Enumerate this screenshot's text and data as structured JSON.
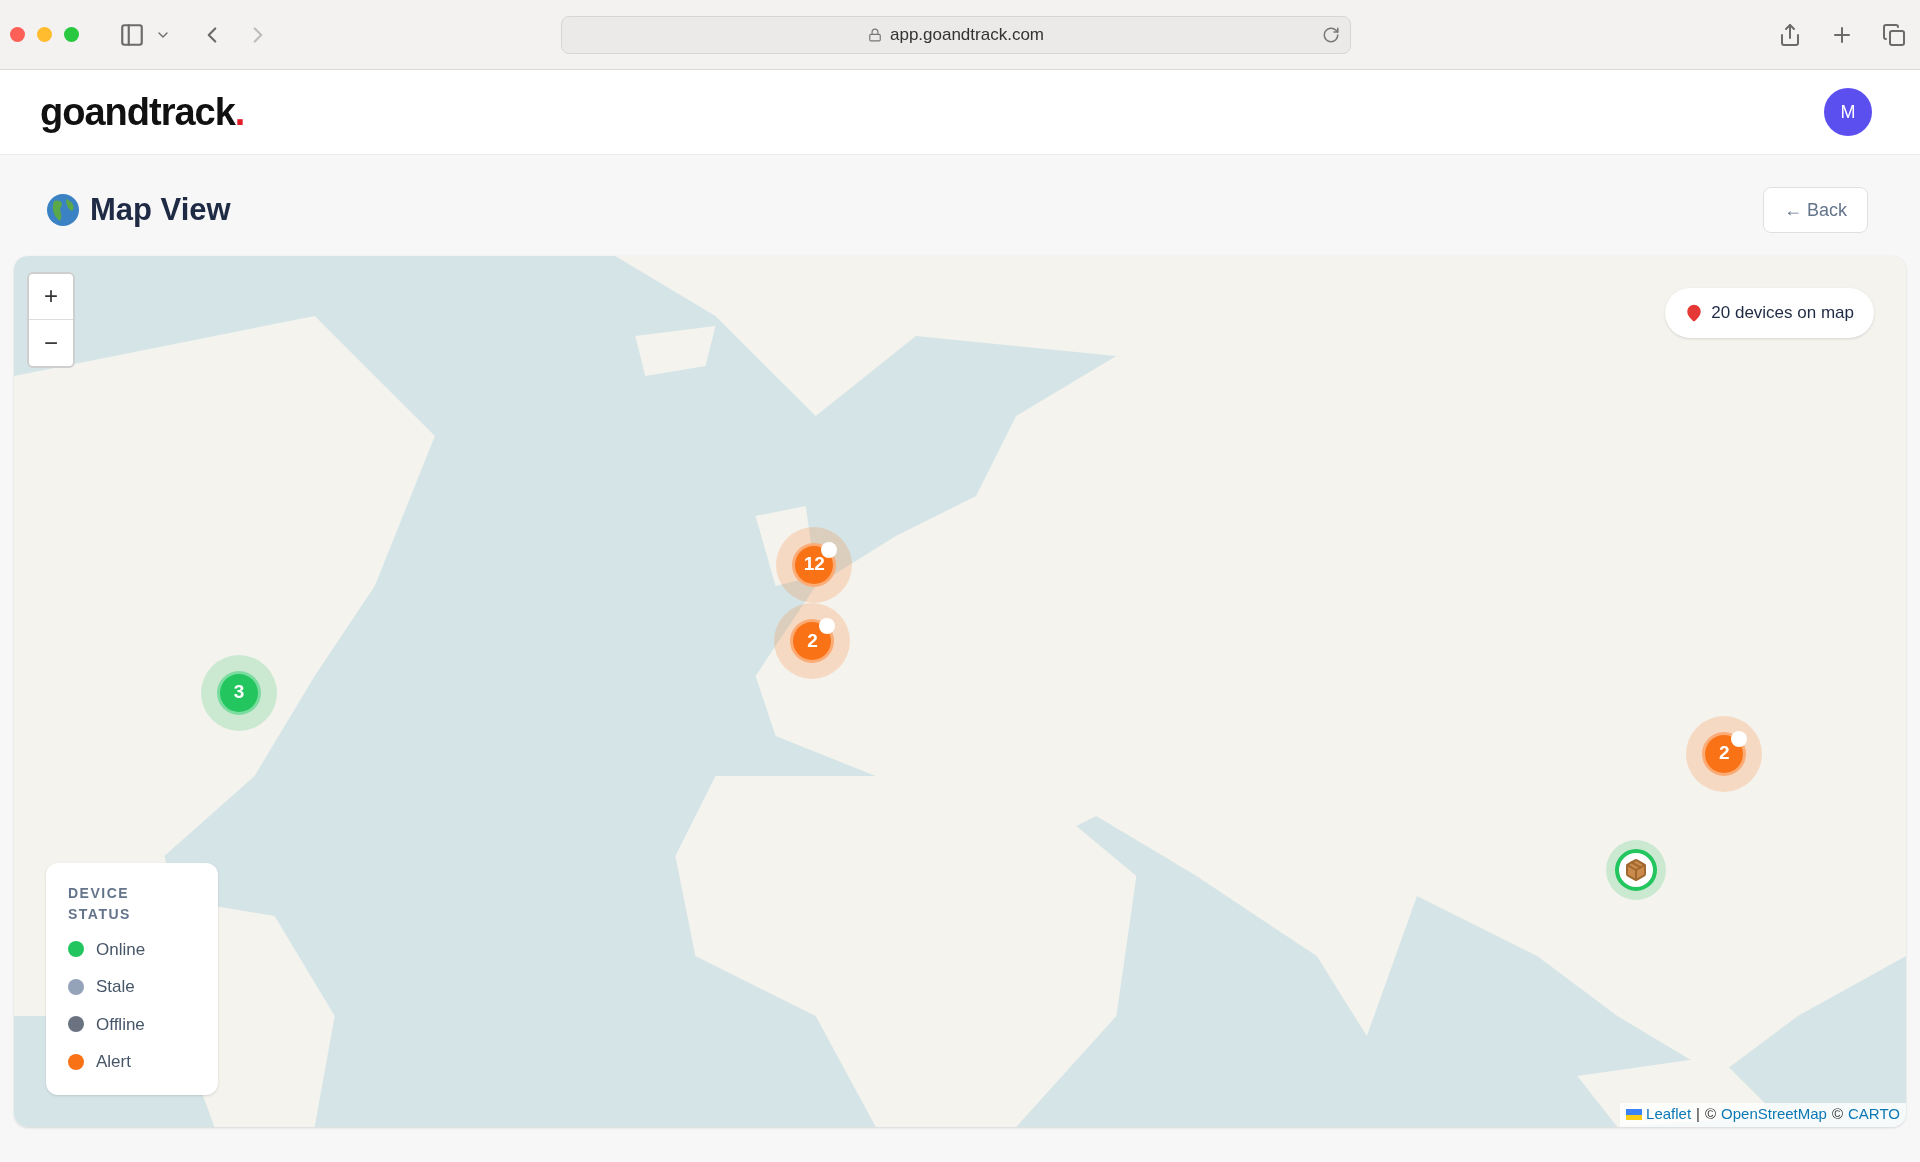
{
  "browser": {
    "url": "app.goandtrack.com"
  },
  "header": {
    "logo": "goandtrack",
    "logo_dot": ".",
    "avatar": "M"
  },
  "page": {
    "title": "Map View",
    "back_button": "← Back"
  },
  "map": {
    "device_count": "20 devices on map",
    "zoom_in": "+",
    "zoom_out": "−",
    "markers": [
      {
        "kind": "cluster",
        "count": "12",
        "color": "#f97316",
        "flag": true
      },
      {
        "kind": "cluster",
        "count": "2",
        "color": "#f97316",
        "flag": true
      },
      {
        "kind": "cluster",
        "count": "3",
        "color": "#22c55e",
        "flag": false
      },
      {
        "kind": "cluster",
        "count": "2",
        "color": "#f97316",
        "flag": true
      },
      {
        "kind": "device",
        "color": "#22c55e"
      }
    ],
    "legend": {
      "title": "DEVICE STATUS",
      "items": [
        {
          "label": "Online",
          "color": "#22c55e"
        },
        {
          "label": "Stale",
          "color": "#94a3b8"
        },
        {
          "label": "Offline",
          "color": "#6b7280"
        },
        {
          "label": "Alert",
          "color": "#f97316"
        }
      ]
    },
    "attribution": [
      {
        "kind": "link",
        "text": "Leaflet",
        "flag": true
      },
      {
        "kind": "text",
        "text": "|"
      },
      {
        "kind": "text",
        "text": "©"
      },
      {
        "kind": "link",
        "text": "OpenStreetMap"
      },
      {
        "kind": "text",
        "text": "©"
      },
      {
        "kind": "link",
        "text": "CARTO"
      }
    ]
  }
}
